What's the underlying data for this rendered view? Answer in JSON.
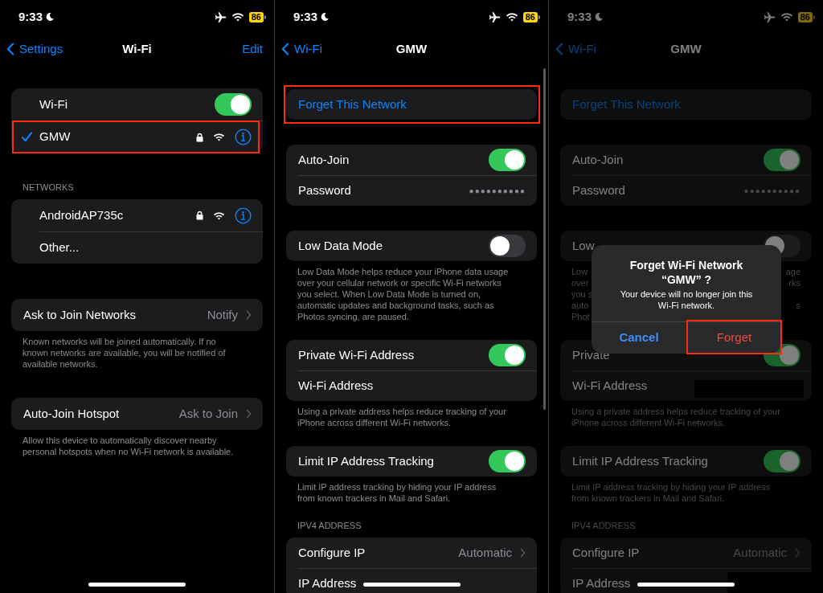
{
  "panels": [
    {
      "kind": "wifi_list",
      "status_bar": {
        "time": "9:33",
        "battery": "86"
      },
      "nav": {
        "back": "Settings",
        "title": "Wi-Fi",
        "action": "Edit"
      },
      "sections": [
        {
          "rows": [
            {
              "kind": "toggle",
              "label": "Wi-Fi",
              "on": true
            },
            {
              "kind": "network",
              "label": "GMW",
              "connected": true,
              "secured": true,
              "highlighted": true
            }
          ]
        },
        {
          "header": "NETWORKS",
          "rows": [
            {
              "kind": "network",
              "label": "AndroidAP735c",
              "connected": false,
              "secured": true,
              "highlighted": false
            },
            {
              "kind": "plain",
              "label": "Other..."
            }
          ]
        },
        {
          "rows": [
            {
              "kind": "disclosure",
              "label": "Ask to Join Networks",
              "value": "Notify"
            }
          ],
          "footer": "Known networks will be joined automatically. If no\nknown networks are available, you will be notified of\navailable networks."
        },
        {
          "rows": [
            {
              "kind": "disclosure",
              "label": "Auto-Join Hotspot",
              "value": "Ask to Join"
            }
          ],
          "footer": "Allow this device to automatically discover nearby\npersonal hotspots when no Wi-Fi network is available."
        }
      ]
    },
    {
      "kind": "network_detail",
      "status_bar": {
        "time": "9:33",
        "battery": "86"
      },
      "nav": {
        "back": "Wi-Fi",
        "title": "GMW"
      },
      "sections": [
        {
          "highlighted": true,
          "rows": [
            {
              "kind": "action",
              "label": "Forget This Network"
            }
          ]
        },
        {
          "rows": [
            {
              "kind": "toggle",
              "label": "Auto-Join",
              "on": true
            },
            {
              "kind": "password",
              "label": "Password",
              "value": "●●●●●●●●●●"
            }
          ]
        },
        {
          "rows": [
            {
              "kind": "toggle",
              "label": "Low Data Mode",
              "on": false
            }
          ],
          "footer": "Low Data Mode helps reduce your iPhone data usage\nover your cellular network or specific Wi-Fi networks\nyou select. When Low Data Mode is turned on,\nautomatic updates and background tasks, such as\nPhotos syncing, are paused."
        },
        {
          "rows": [
            {
              "kind": "toggle",
              "label": "Private Wi-Fi Address",
              "on": true
            },
            {
              "kind": "plain",
              "label": "Wi-Fi Address"
            }
          ],
          "footer": "Using a private address helps reduce tracking of your\niPhone across different Wi-Fi networks."
        },
        {
          "rows": [
            {
              "kind": "toggle",
              "label": "Limit IP Address Tracking",
              "on": true
            }
          ],
          "footer": "Limit IP address tracking by hiding your IP address\nfrom known trackers in Mail and Safari."
        },
        {
          "header": "IPV4 ADDRESS",
          "rows": [
            {
              "kind": "disclosure",
              "label": "Configure IP",
              "value": "Automatic"
            },
            {
              "kind": "plain",
              "label": "IP Address"
            }
          ]
        }
      ]
    },
    {
      "kind": "network_detail",
      "dimmed": true,
      "status_bar": {
        "time": "9:33",
        "battery": "86"
      },
      "nav": {
        "back": "Wi-Fi",
        "title": "GMW"
      },
      "sections": [
        {
          "rows": [
            {
              "kind": "action",
              "label": "Forget This Network"
            }
          ]
        },
        {
          "rows": [
            {
              "kind": "toggle",
              "label": "Auto-Join",
              "on": true
            },
            {
              "kind": "password",
              "label": "Password",
              "value": "●●●●●●●●●●"
            }
          ]
        },
        {
          "rows": [
            {
              "kind": "toggle",
              "label": "Low",
              "on": false
            }
          ],
          "footer_fragments": [
            {
              "left": "Low",
              "right": "age"
            },
            {
              "left": "over",
              "right": "rks"
            },
            {
              "left": "you s"
            },
            {
              "left": "auto",
              "right": "s"
            },
            {
              "left": "Phot"
            }
          ]
        },
        {
          "rows": [
            {
              "kind": "toggle",
              "label": "Private",
              "on": true
            },
            {
              "kind": "plain",
              "label": "Wi-Fi Address",
              "redacted": true
            }
          ],
          "footer": "Using a private address helps reduce tracking of your\niPhone across different Wi-Fi networks."
        },
        {
          "rows": [
            {
              "kind": "toggle",
              "label": "Limit IP Address Tracking",
              "on": true
            }
          ],
          "footer": "Limit IP address tracking by hiding your IP address\nfrom known trackers in Mail and Safari."
        },
        {
          "header": "IPV4 ADDRESS",
          "rows": [
            {
              "kind": "disclosure",
              "label": "Configure IP",
              "value": "Automatic"
            },
            {
              "kind": "plain",
              "label": "IP Address",
              "redacted": true
            }
          ]
        }
      ],
      "alert": {
        "title": "Forget Wi-Fi Network\n“GMW” ?",
        "message": "Your device will no longer join this\nWi-Fi network.",
        "buttons": [
          {
            "kind": "cancel",
            "label": "Cancel",
            "highlighted": false
          },
          {
            "kind": "destructive",
            "label": "Forget",
            "highlighted": true
          }
        ]
      }
    }
  ]
}
